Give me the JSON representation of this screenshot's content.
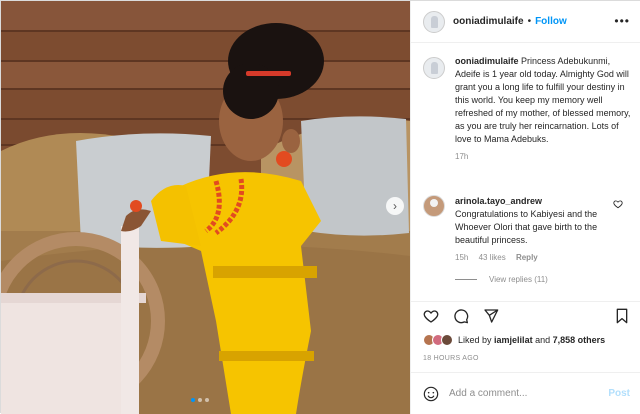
{
  "colors": {
    "accent": "#0095f6",
    "muted": "#8e8e8e",
    "text": "#262626",
    "post_disabled": "#b2dffc"
  },
  "header": {
    "username": "ooniadimulaife",
    "separator": "•",
    "follow_label": "Follow",
    "more_icon": "more-horizontal-icon",
    "more_glyph": "•••"
  },
  "caption": {
    "username": "ooniadimulaife",
    "text": "Princess Adebukunmi, Adeife is 1 year old today. Almighty God will grant you a long life to fulfill your destiny in this world. You keep my memory well refreshed of my mother, of blessed memory, as you are truly her reincarnation. Lots of love to Mama Adebuks.",
    "time": "17h"
  },
  "comment": {
    "username": "arinola.tayo_andrew",
    "text": "Congratulations to Kabiyesi and the Whoever Olori that gave birth to the beautiful princess.",
    "time": "15h",
    "likes": "43 likes",
    "reply_label": "Reply",
    "view_replies": "View replies (11)"
  },
  "actions": {
    "like_icon": "heart-icon",
    "comment_icon": "comment-icon",
    "share_icon": "send-icon",
    "save_icon": "bookmark-icon"
  },
  "likes": {
    "prefix": "Liked by ",
    "user": "iamjelilat",
    "middle": " and ",
    "others": "7,858 others"
  },
  "timestamp": "18 HOURS AGO",
  "add_comment": {
    "placeholder": "Add a comment...",
    "post_label": "Post"
  },
  "carousel": {
    "slides": 3,
    "active_index": 0,
    "next_glyph": "›"
  }
}
